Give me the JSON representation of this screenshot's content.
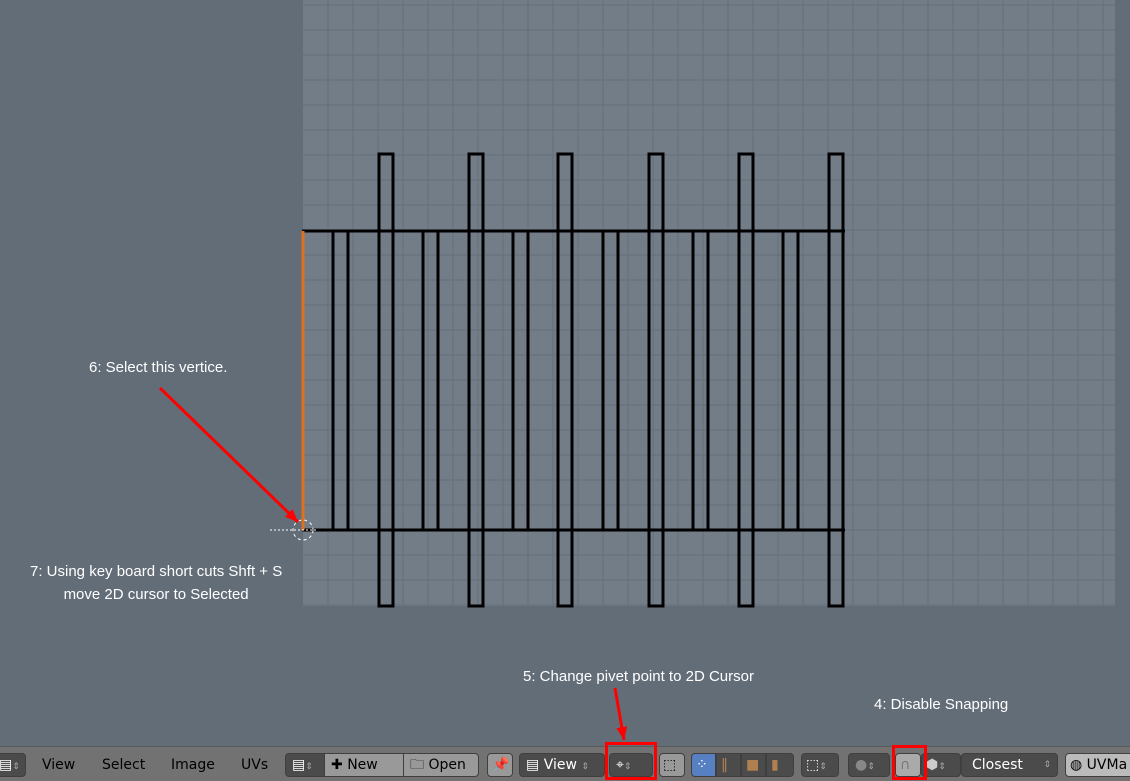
{
  "annotations": {
    "step6": "6: Select this vertice.",
    "step7_line1": "7: Using key board short cuts  Shft  + S",
    "step7_line2": "move 2D cursor to Selected",
    "step5": "5: Change pivet point to 2D Cursor",
    "step4": "4: Disable Snapping"
  },
  "menu": [
    "View",
    "Select",
    "Image",
    "UVs"
  ],
  "toolbar": {
    "new_label": "New",
    "open_label": "Open",
    "view_label": "View",
    "snap_target": "Closest",
    "uvmap_label": "UVMa"
  },
  "icons": [
    "editor-type-icon",
    "image-browse-icon",
    "plus-icon",
    "folder-icon",
    "pin-icon",
    "pivot-2d-cursor-icon",
    "sticky-select-icon",
    "select-mode-icons",
    "proportional-edit-icon",
    "snap-magnet-icon",
    "snap-element-icon",
    "uv-grid-icon"
  ],
  "colors": {
    "highlight": "#ff0000",
    "grid_bg": "#737d88",
    "bg": "#636d78"
  }
}
